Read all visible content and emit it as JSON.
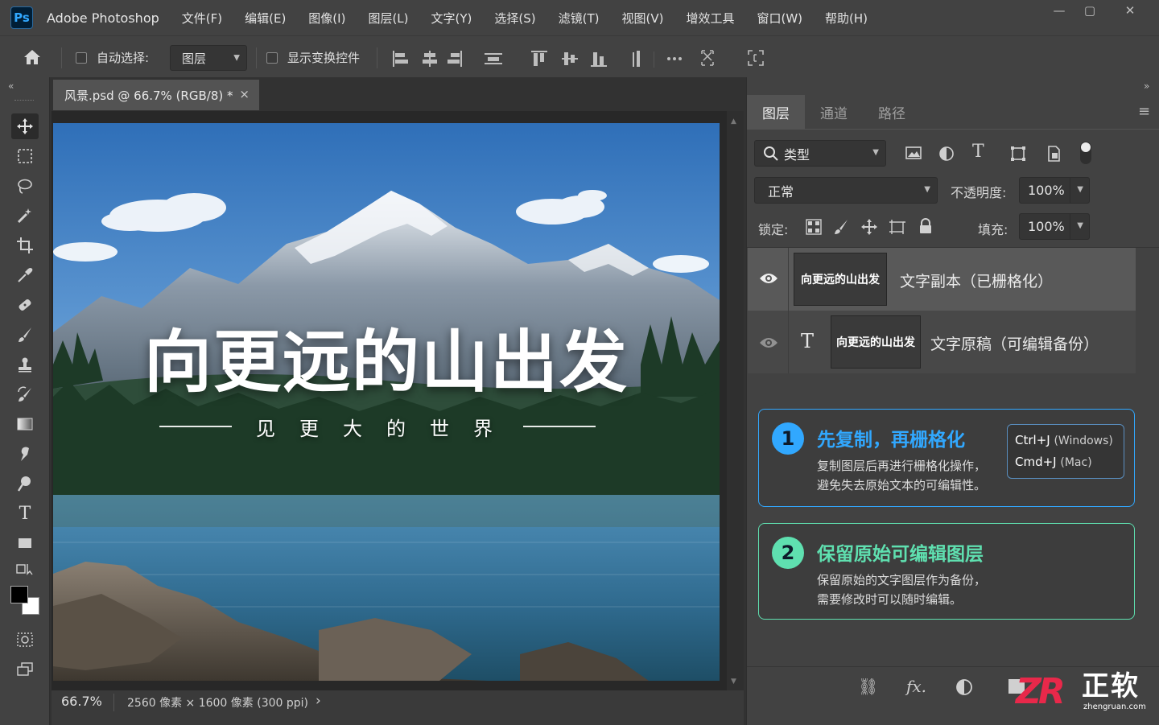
{
  "app": {
    "logo": "Ps",
    "name": "Adobe Photoshop"
  },
  "menu": [
    "文件(F)",
    "编辑(E)",
    "图像(I)",
    "图层(L)",
    "文字(Y)",
    "选择(S)",
    "滤镜(T)",
    "视图(V)",
    "增效工具",
    "窗口(W)",
    "帮助(H)"
  ],
  "window_controls": {
    "minimize": "—",
    "maximize": "▢",
    "close": "✕"
  },
  "options": {
    "auto_select_label": "自动选择:",
    "auto_select_value": "图层",
    "show_transform_label": "显示变换控件",
    "more": "•••"
  },
  "document": {
    "tab_title": "风景.psd @ 66.7% (RGB/8) *",
    "close": "×",
    "zoom": "66.7%",
    "info": "2560 像素 × 1600 像素 (300 ppi)",
    "info_arrow": "›"
  },
  "artwork": {
    "headline": "向更远的山出发",
    "subline": "见更大的世界"
  },
  "panel": {
    "collapse_left": "«",
    "collapse_right": "»",
    "tabs": [
      "图层",
      "通道",
      "路径"
    ],
    "menu_icon": "≡",
    "filter_value": "类型",
    "blend_mode": "正常",
    "opacity_label": "不透明度:",
    "opacity_value": "100%",
    "lock_label": "锁定:",
    "fill_label": "填充:",
    "fill_value": "100%",
    "layers": [
      {
        "thumb_text": "向更远的山出发",
        "name": "文字副本（已栅格化）",
        "visible": true,
        "selected": true,
        "type": "raster"
      },
      {
        "thumb_text": "向更远的山出发",
        "name": "文字原稿（可编辑备份）",
        "visible": true,
        "selected": false,
        "type": "text",
        "type_glyph": "T"
      }
    ]
  },
  "tips": [
    {
      "number": "1",
      "title": "先复制，再栅格化",
      "desc_line1": "复制图层后再进行栅格化操作，",
      "desc_line2": "避免失去原始文本的可编辑性。",
      "shortcut1_key": "Ctrl+J",
      "shortcut1_os": "(Windows)",
      "shortcut2_key": "Cmd+J",
      "shortcut2_os": "(Mac)",
      "color": "#31a8ff"
    },
    {
      "number": "2",
      "title": "保留原始可编辑图层",
      "desc_line1": "保留原始的文字图层作为备份，",
      "desc_line2": "需要修改时可以随时编辑。",
      "color": "#5fe0b0"
    }
  ],
  "panel_footer": {
    "link_icon": "⛓",
    "fx_label": "fx."
  },
  "watermark": {
    "mark": "ZR",
    "name": "正软",
    "url": "zhengruan.com"
  },
  "colors": {
    "accent_blue": "#31a8ff",
    "accent_green": "#5fe0b0",
    "watermark_red": "#e8284a"
  }
}
